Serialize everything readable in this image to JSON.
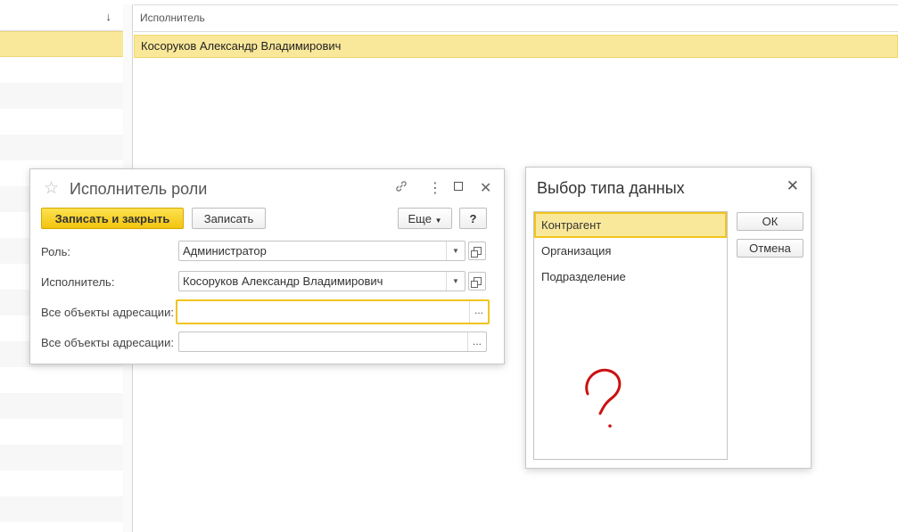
{
  "left_panel": {
    "sort_icon": "↓"
  },
  "right_panel": {
    "column_header": "Исполнитель",
    "rows": [
      "Косоруков Александр Владимирович"
    ]
  },
  "dialog_role": {
    "title": "Исполнитель роли",
    "buttons": {
      "save_close": "Записать и закрыть",
      "save": "Записать",
      "more": "Еще",
      "help": "?"
    },
    "fields": {
      "role_label": "Роль:",
      "role_value": "Администратор",
      "executor_label": "Исполнитель:",
      "executor_value": "Косоруков Александр Владимирович",
      "objects1_label": "Все объекты адресации:",
      "objects1_value": "",
      "objects2_label": "Все объекты адресации:",
      "objects2_value": ""
    },
    "icons": {
      "star": "star-icon",
      "link": "link-icon",
      "more": "more-vertical-icon",
      "maximize": "maximize-icon",
      "close": "close-icon"
    }
  },
  "dialog_type": {
    "title": "Выбор типа данных",
    "items": [
      "Контрагент",
      "Организация",
      "Подразделение"
    ],
    "selected_index": 0,
    "buttons": {
      "ok": "ОК",
      "cancel": "Отмена"
    }
  },
  "annotation_color": "#cc1111",
  "accent_color": "#f1c41d"
}
